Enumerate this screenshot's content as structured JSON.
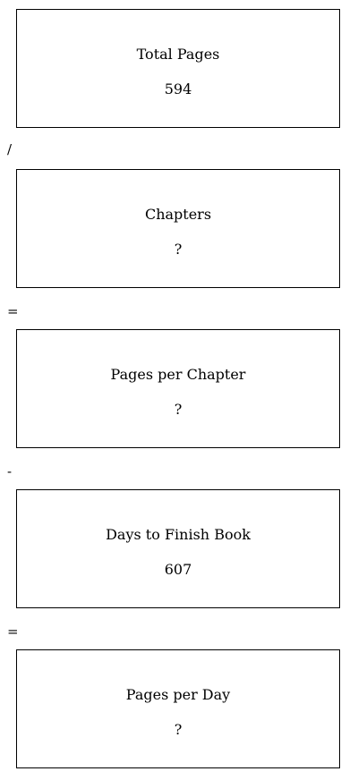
{
  "boxes": [
    {
      "label": "Total Pages",
      "value": "594"
    },
    {
      "label": "Chapters",
      "value": "?"
    },
    {
      "label": "Pages per Chapter",
      "value": "?"
    },
    {
      "label": "Days to Finish Book",
      "value": "607"
    },
    {
      "label": "Pages per Day",
      "value": "?"
    }
  ],
  "operators": [
    "/",
    "=",
    "-",
    "="
  ]
}
